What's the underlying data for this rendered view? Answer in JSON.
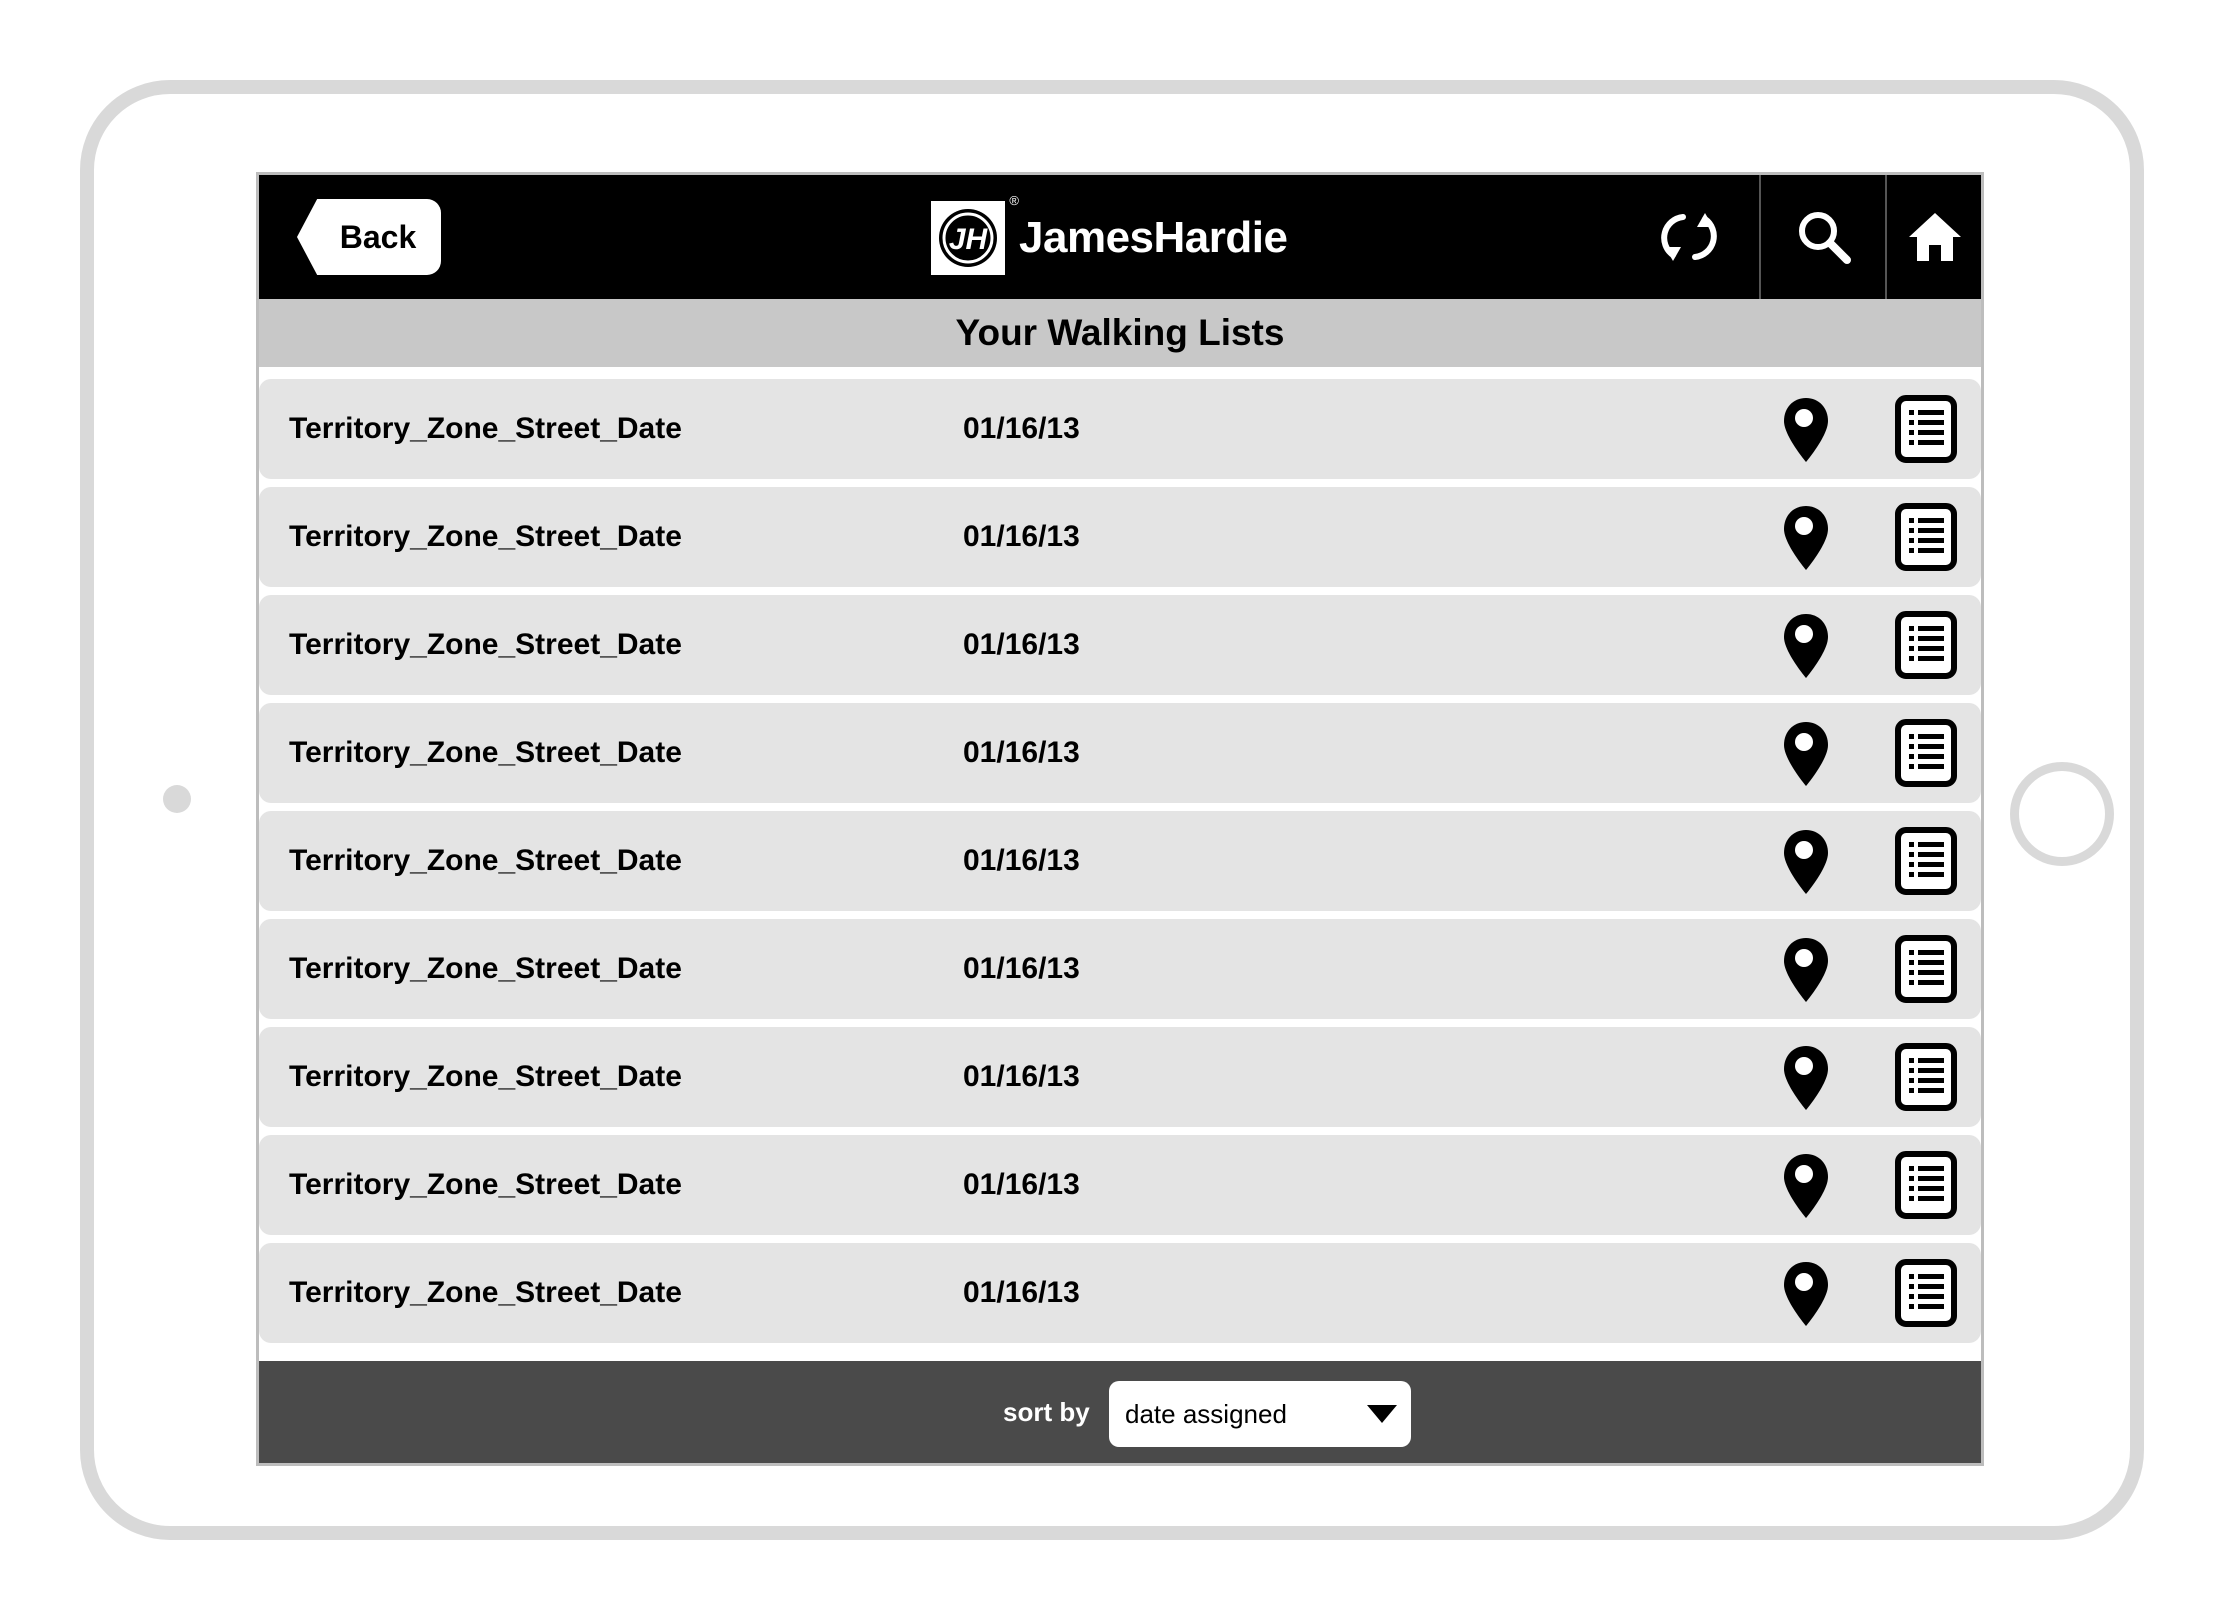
{
  "header": {
    "back_label": "Back",
    "brand_name": "JamesHardie",
    "brand_mark": "JH",
    "registered": "®",
    "icons": [
      "sync-icon",
      "search-icon",
      "home-icon"
    ]
  },
  "page_title": "Your Walking Lists",
  "list": {
    "items": [
      {
        "name": "Territory_Zone_Street_Date",
        "date": "01/16/13"
      },
      {
        "name": "Territory_Zone_Street_Date",
        "date": "01/16/13"
      },
      {
        "name": "Territory_Zone_Street_Date",
        "date": "01/16/13"
      },
      {
        "name": "Territory_Zone_Street_Date",
        "date": "01/16/13"
      },
      {
        "name": "Territory_Zone_Street_Date",
        "date": "01/16/13"
      },
      {
        "name": "Territory_Zone_Street_Date",
        "date": "01/16/13"
      },
      {
        "name": "Territory_Zone_Street_Date",
        "date": "01/16/13"
      },
      {
        "name": "Territory_Zone_Street_Date",
        "date": "01/16/13"
      },
      {
        "name": "Territory_Zone_Street_Date",
        "date": "01/16/13"
      }
    ],
    "row_icons": [
      "map-pin-icon",
      "list-icon"
    ]
  },
  "footer": {
    "sort_label": "sort by",
    "sort_value": "date assigned"
  },
  "colors": {
    "header_bg": "#000000",
    "title_bar_bg": "#c8c8c8",
    "row_bg": "#e4e4e4",
    "footer_bg": "#4a4a4a",
    "device_frame": "#d9d9d9"
  }
}
